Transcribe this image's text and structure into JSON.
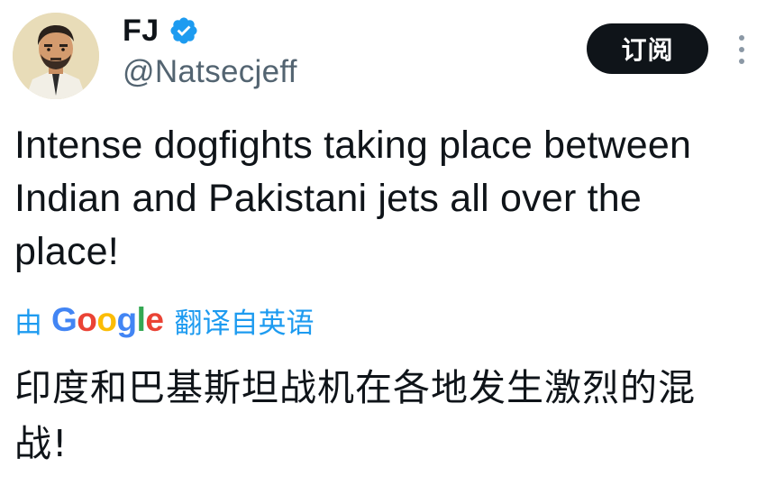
{
  "author": {
    "display_name": "FJ",
    "handle": "@Natsecjeff",
    "verified": true
  },
  "actions": {
    "subscribe_label": "订阅",
    "more_icon": "more-vertical-icon"
  },
  "tweet": {
    "text": "Intense dogfights taking place between Indian and Pakistani jets all over the place!"
  },
  "translation": {
    "prefix": "由",
    "provider_letters": [
      "G",
      "o",
      "o",
      "g",
      "l",
      "e"
    ],
    "suffix": "翻译自英语",
    "text": "印度和巴基斯坦战机在各地发生激烈的混战!"
  },
  "colors": {
    "verified_blue": "#1d9bf0",
    "link_blue": "#1d9bf0",
    "handle_gray": "#536471",
    "button_black": "#0f1419",
    "google_blue": "#4285f4",
    "google_red": "#ea4335",
    "google_yellow": "#fbbc05",
    "google_green": "#34a853"
  }
}
